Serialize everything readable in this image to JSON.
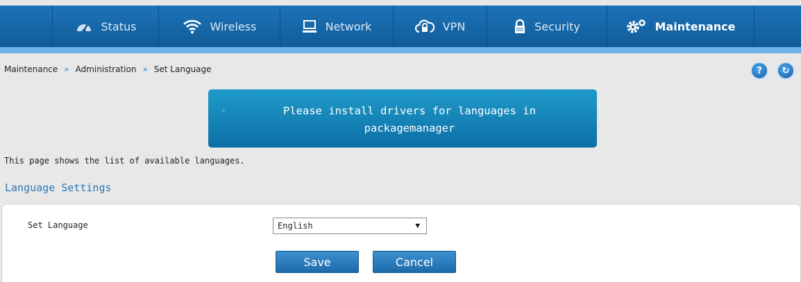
{
  "nav": {
    "items": [
      {
        "label": "Status",
        "icon": "gauge-icon"
      },
      {
        "label": "Wireless",
        "icon": "wifi-icon"
      },
      {
        "label": "Network",
        "icon": "monitor-icon"
      },
      {
        "label": "VPN",
        "icon": "cloud-lock-icon"
      },
      {
        "label": "Security",
        "icon": "lock-icon"
      },
      {
        "label": "Maintenance",
        "icon": "gears-icon"
      }
    ],
    "active": "Maintenance"
  },
  "breadcrumb": {
    "items": [
      "Maintenance",
      "Administration",
      "Set Language"
    ],
    "separator": "»"
  },
  "header_buttons": {
    "help_label": "?",
    "refresh_label": "↻"
  },
  "notice": {
    "bullet": "◦",
    "message": "Please install drivers for languages in packagemanager"
  },
  "page_description": "This page shows the list of available languages.",
  "section": {
    "title": "Language Settings",
    "field_label": "Set Language",
    "select_value": "English",
    "select_arrow": "▼"
  },
  "buttons": {
    "save_label": "Save",
    "cancel_label": "Cancel"
  },
  "colors": {
    "nav_bg": "#1c73b8",
    "nav_underline": "#6fb3ea",
    "notice_bg": "#1f9bc9",
    "section_title": "#2f77b4",
    "button_bg": "#3f90cf"
  }
}
